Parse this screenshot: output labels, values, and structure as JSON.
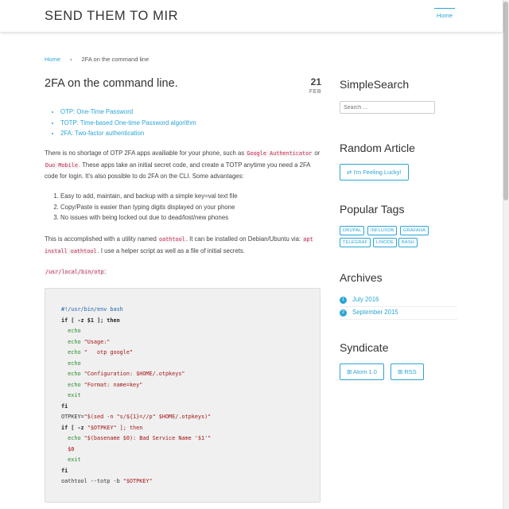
{
  "header": {
    "site_title": "SEND THEM TO MIR",
    "nav_home": "Home"
  },
  "breadcrumb": {
    "home": "Home",
    "separator": "›",
    "current": "2FA on the command line"
  },
  "post": {
    "title": "2FA on the command line.",
    "date_day": "21",
    "date_month": "FEB",
    "toc": [
      "OTP: One-Time Password",
      "TOTP: Time-based One-time Password algorithm",
      "2FA: Two-factor authentication"
    ],
    "para1": {
      "t1": "There is no shortage of OTP 2FA apps availiable for your phone, such as ",
      "c1": "Google Authenticator",
      "t2": " or ",
      "c2": "Duo Mobile",
      "t3": ". These apps take an initial secret code, and create a TOTP anytime you need a 2FA code for login. It's also possible to do 2FA on the CLI. Some advantages:"
    },
    "advantages": [
      "Easy to add, maintain, and backup with a simple key=val text file",
      "Copy/Paste is easier than typing digits displayed on your phone",
      "No issues with being locked out due to dead/lost/new phones"
    ],
    "para2": {
      "t1": "This is accomplished with a utility named ",
      "c1": "oathtool",
      "t2": ". It can be installed on Debian/Ubuntu via: ",
      "c2": "apt install oathtool",
      "t3": ". I use a helper script as well as a file of initial secrets."
    },
    "code_filename": "/usr/local/bin/otp",
    "code_filename_suffix": ":",
    "code_lines": [
      "#!/usr/bin/env bash",
      "if [ -z $1 ]; then",
      "  echo",
      "  echo \"Usage:\"",
      "  echo \"   otp google\"",
      "  echo",
      "  echo \"Configuration: $HOME/.otpkeys\"",
      "  echo \"Format: name=key\"",
      "  exit",
      "fi",
      "OTPKEY=\"$(sed -n \"s/${1}=//p\" $HOME/.otpkeys)\"",
      "if [ -z \"$OTPKEY\" ]; then",
      "  echo \"$(basename $0): Bad Service Name '$1'\"",
      "  $0",
      "  exit",
      "fi",
      "oathtool --totp -b \"$OTPKEY\""
    ]
  },
  "sidebar": {
    "search_heading": "SimpleSearch",
    "search_placeholder": "Search ...",
    "random_heading": "Random Article",
    "random_button": "⇄ I'm Feeling Lucky!",
    "tags_heading": "Popular Tags",
    "tags": [
      "DRUPAL",
      "INFLUXDB",
      "GRAFANA",
      "TELEGRAF",
      "LINODE",
      "BASH"
    ],
    "archives_heading": "Archives",
    "archives": [
      {
        "count": "1",
        "label": "July 2016"
      },
      {
        "count": "2",
        "label": "September 2015"
      }
    ],
    "syndicate_heading": "Syndicate",
    "atom_button": "⊞ Atom 1.0",
    "rss_button": "⊞ RSS"
  },
  "colors": {
    "accent": "#2aa5d4",
    "code_text": "#c7254e",
    "code_bg": "#f0f0f0"
  }
}
